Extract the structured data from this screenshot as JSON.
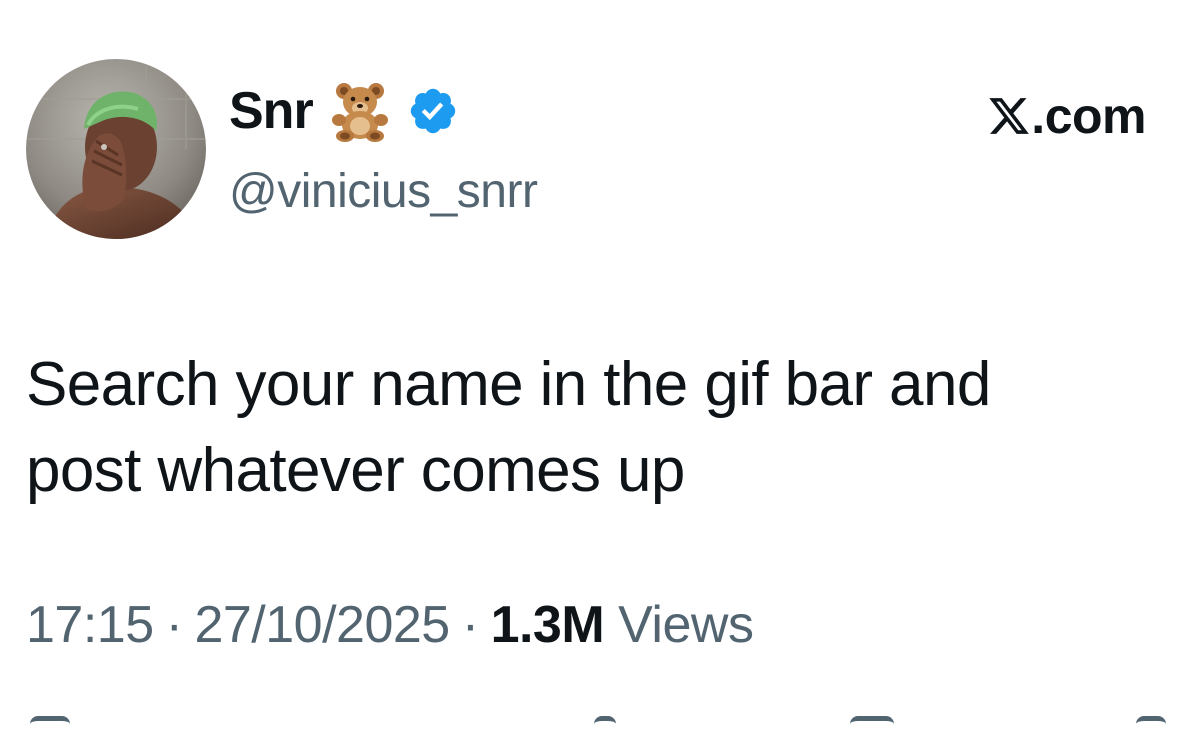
{
  "author": {
    "display_name": "Snr",
    "emoji": "teddy-bear-icon",
    "verified": true,
    "handle": "@vinicius_snrr"
  },
  "brand": {
    "logo": "x-logo-icon",
    "label": ".com"
  },
  "tweet": {
    "text": "Search your name in the gif bar and\npost whatever comes up"
  },
  "meta": {
    "time": "17:15",
    "separator": "·",
    "date": "27/10/2025",
    "views_count": "1.3M",
    "views_label": "Views"
  },
  "colors": {
    "text_primary": "#0f1419",
    "text_secondary": "#536471",
    "verified_blue": "#1d9bf0"
  }
}
